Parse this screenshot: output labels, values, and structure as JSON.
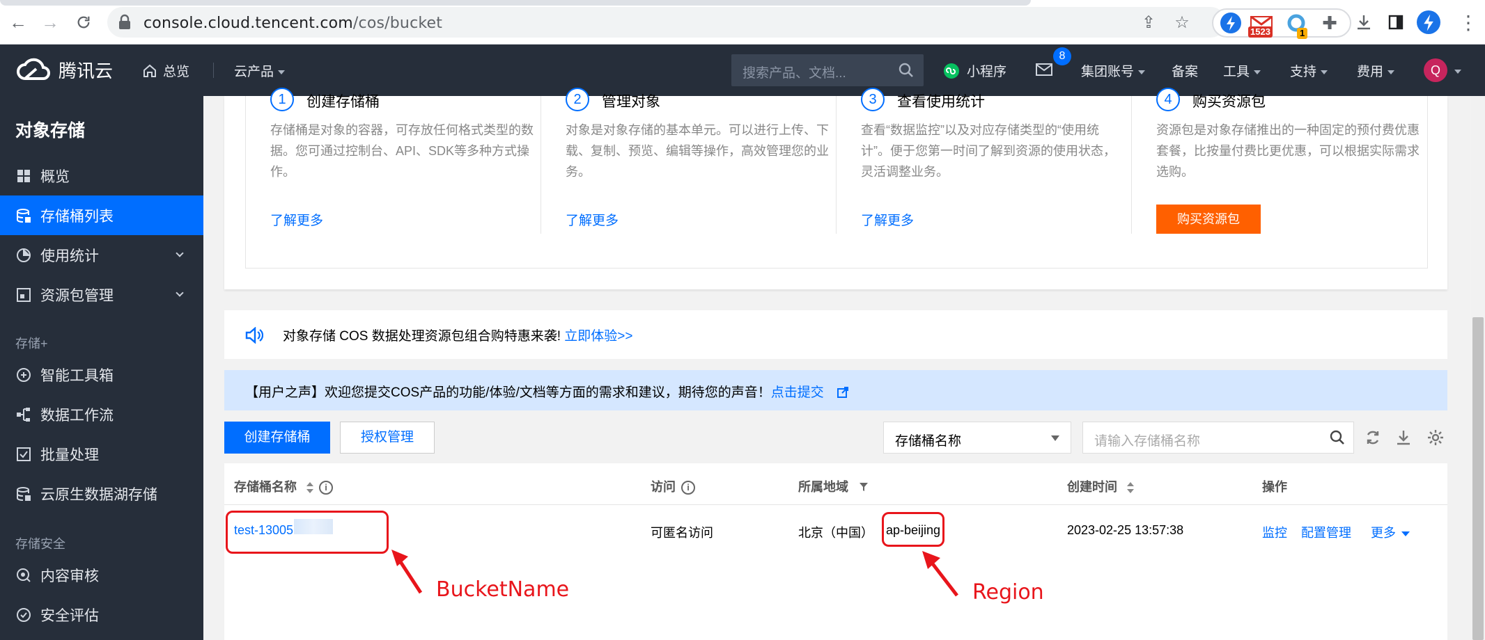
{
  "browser": {
    "url_host": "console.cloud.tencent.com",
    "url_path": "/cos/bucket",
    "mail_badge": "1523",
    "ext_badge": "1"
  },
  "topnav": {
    "brand": "腾讯云",
    "overview": "总览",
    "products": "云产品",
    "search_placeholder": "搜索产品、文档...",
    "mini_program": "小程序",
    "notification_count": "8",
    "group_account": "集团账号",
    "record": "备案",
    "tools": "工具",
    "support": "支持",
    "billing": "费用",
    "avatar_letter": "Q"
  },
  "sidebar": {
    "title": "对象存储",
    "items": [
      {
        "label": "概览"
      },
      {
        "label": "存储桶列表"
      },
      {
        "label": "使用统计"
      },
      {
        "label": "资源包管理"
      }
    ],
    "group_storage_plus": "存储+",
    "storage_plus_items": [
      {
        "label": "智能工具箱"
      },
      {
        "label": "数据工作流"
      },
      {
        "label": "批量处理"
      },
      {
        "label": "云原生数据湖存储"
      }
    ],
    "group_security": "存储安全",
    "security_items": [
      {
        "label": "内容审核"
      },
      {
        "label": "安全评估"
      }
    ]
  },
  "steps": [
    {
      "num": "1",
      "title": "创建存储桶",
      "desc": "存储桶是对象的容器，可存放任何格式类型的数据。您可通过控制台、API、SDK等多种方式操作。",
      "link": "了解更多"
    },
    {
      "num": "2",
      "title": "管理对象",
      "desc": "对象是对象存储的基本单元。可以进行上传、下载、复制、预览、编辑等操作，高效管理您的业务。",
      "link": "了解更多"
    },
    {
      "num": "3",
      "title": "查看使用统计",
      "desc": "查看“数据监控”以及对应存储类型的“使用统计”。便于您第一时间了解到资源的使用状态，灵活调整业务。",
      "link": "了解更多"
    },
    {
      "num": "4",
      "title": "购买资源包",
      "desc": "资源包是对象存储推出的一种固定的预付费优惠套餐，比按量付费比更优惠，可以根据实际需求选购。",
      "button": "购买资源包"
    }
  ],
  "announcement": {
    "text": "对象存储 COS 数据处理资源包组合购特惠来袭!",
    "link": "立即体验>>"
  },
  "user_voice": {
    "text": "【用户之声】欢迎您提交COS产品的功能/体验/文档等方面的需求和建议，期待您的声音！",
    "link": "点击提交"
  },
  "toolbar": {
    "create_bucket": "创建存储桶",
    "auth_manage": "授权管理",
    "filter_select": "存储桶名称",
    "search_placeholder": "请输入存储桶名称"
  },
  "table": {
    "headers": {
      "name": "存储桶名称",
      "access": "访问",
      "region": "所属地域",
      "created": "创建时间",
      "actions": "操作"
    },
    "rows": [
      {
        "name": "test-13005",
        "access": "可匿名访问",
        "region": "北京（中国）",
        "region_code": "ap-beijing",
        "created": "2023-02-25 13:57:38",
        "action_monitor": "监控",
        "action_config": "配置管理",
        "action_more": "更多"
      }
    ]
  },
  "annotations": {
    "bucket_label": "BucketName",
    "region_label": "Region",
    "color": "#e8151b"
  },
  "colors": {
    "accent": "#006eff",
    "nav_bg": "#262e3a",
    "buy_button": "#ff6000"
  }
}
